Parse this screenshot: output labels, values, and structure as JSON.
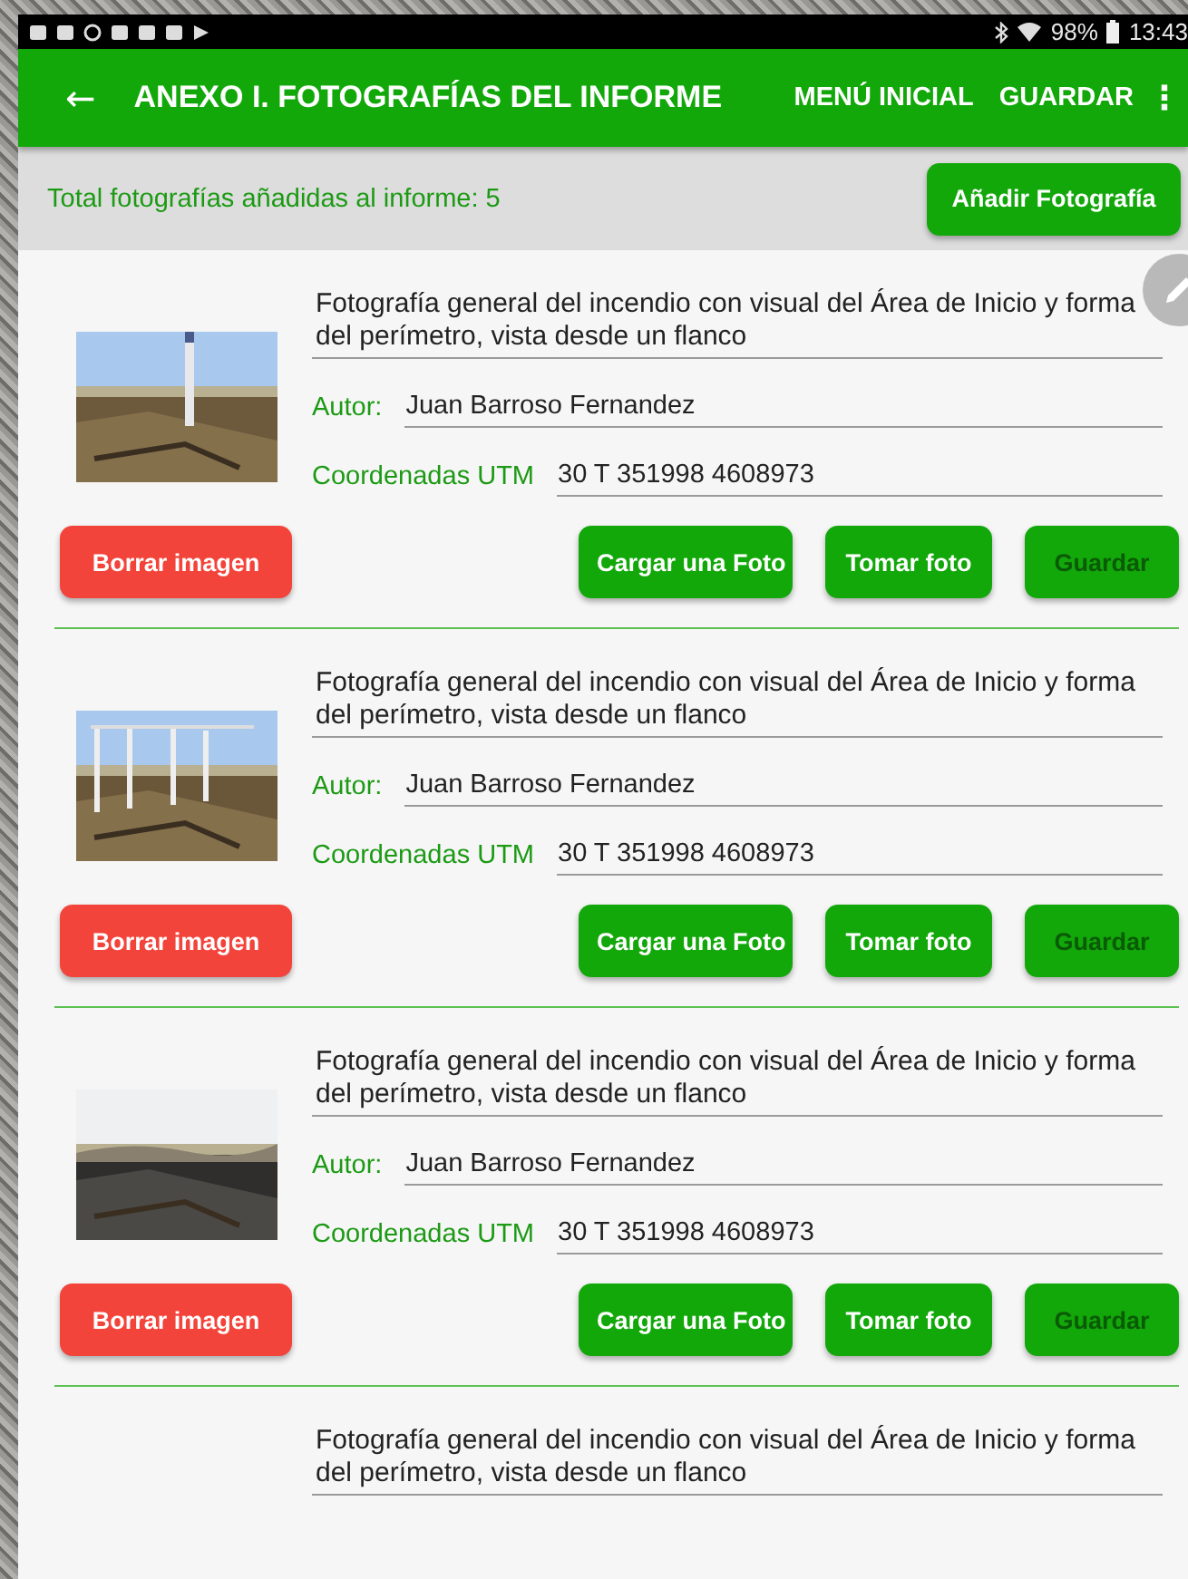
{
  "status_bar": {
    "battery": "98%",
    "time": "13:43"
  },
  "toolbar": {
    "back": "←",
    "title": "ANEXO I. FOTOGRAFÍAS DEL INFORME",
    "actions": [
      "MENÚ INICIAL",
      "GUARDAR"
    ],
    "overflow": "⋮"
  },
  "summary": {
    "text": "Total fotografías añadidas al informe: 5",
    "button": "Añadir Fotografía"
  },
  "cards": [
    {
      "kind": "full",
      "description": "Fotografía general del incendio con visual del Área de Inicio y forma del perímetro, vista desde un flanco",
      "author_label": "Autor:",
      "author": "Juan Barroso Fernandez",
      "coords_label": "Coordenadas UTM",
      "coords": "30 T 351998 4608973",
      "buttons": [
        {
          "label": "Borrar imagen",
          "kind": "danger",
          "disabled": false
        },
        {
          "label": "Cargar una Foto",
          "kind": "primary",
          "disabled": false
        },
        {
          "label": "Tomar foto",
          "kind": "primary",
          "disabled": false
        },
        {
          "label": "Guardar",
          "kind": "primary",
          "disabled": true
        }
      ]
    },
    {
      "kind": "full",
      "description": "Fotografía general del incendio con visual del Área de Inicio y forma del perímetro, vista desde un flanco",
      "author_label": "Autor:",
      "author": "Juan Barroso Fernandez",
      "coords_label": "Coordenadas UTM",
      "coords": "30 T 351998 4608973",
      "buttons": [
        {
          "label": "Borrar imagen",
          "kind": "danger",
          "disabled": false
        },
        {
          "label": "Cargar una Foto",
          "kind": "primary",
          "disabled": false
        },
        {
          "label": "Tomar foto",
          "kind": "primary",
          "disabled": false
        },
        {
          "label": "Guardar",
          "kind": "primary",
          "disabled": true
        }
      ]
    },
    {
      "kind": "full",
      "description": "Fotografía general del incendio con visual del Área de Inicio y forma del perímetro, vista desde un flanco",
      "author_label": "Autor:",
      "author": "Juan Barroso Fernandez",
      "coords_label": "Coordenadas UTM",
      "coords": "30 T 351998 4608973",
      "buttons": [
        {
          "label": "Borrar imagen",
          "kind": "danger",
          "disabled": false
        },
        {
          "label": "Cargar una Foto",
          "kind": "primary",
          "disabled": false
        },
        {
          "label": "Tomar foto",
          "kind": "primary",
          "disabled": false
        },
        {
          "label": "Guardar",
          "kind": "primary",
          "disabled": true
        }
      ]
    },
    {
      "kind": "partial",
      "description": "Fotografía general del incendio con visual del Área de Inicio y forma del perímetro, vista desde un flanco"
    }
  ]
}
